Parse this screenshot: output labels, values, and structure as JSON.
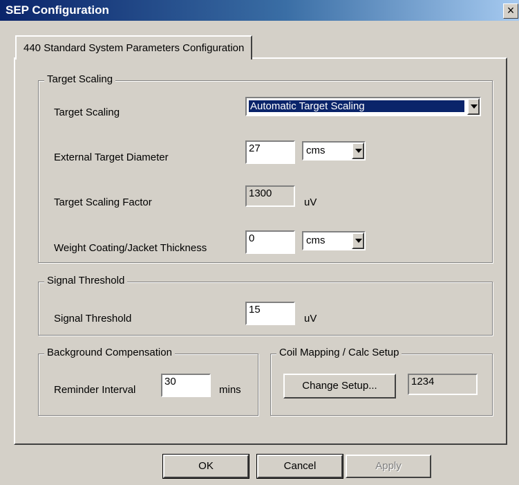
{
  "window": {
    "title": "SEP Configuration",
    "close_glyph": "×"
  },
  "tab": {
    "label": "440 Standard System Parameters Configuration"
  },
  "target_scaling": {
    "legend": "Target Scaling",
    "scaling_label": "Target Scaling",
    "scaling_value": "Automatic Target Scaling",
    "ext_diam_label": "External Target Diameter",
    "ext_diam_value": "27",
    "ext_diam_unit": "cms",
    "factor_label": "Target Scaling Factor",
    "factor_value": "1300",
    "factor_unit": "uV",
    "coating_label": "Weight Coating/Jacket Thickness",
    "coating_value": "0",
    "coating_unit": "cms"
  },
  "signal_threshold": {
    "legend": "Signal Threshold",
    "label": "Signal Threshold",
    "value": "15",
    "unit": "uV"
  },
  "background": {
    "legend": "Background Compensation",
    "label": "Reminder Interval",
    "value": "30",
    "unit": "mins"
  },
  "coil": {
    "legend": "Coil Mapping / Calc Setup",
    "button": "Change Setup...",
    "value": "1234"
  },
  "footer": {
    "ok": "OK",
    "cancel": "Cancel",
    "apply": "Apply"
  }
}
